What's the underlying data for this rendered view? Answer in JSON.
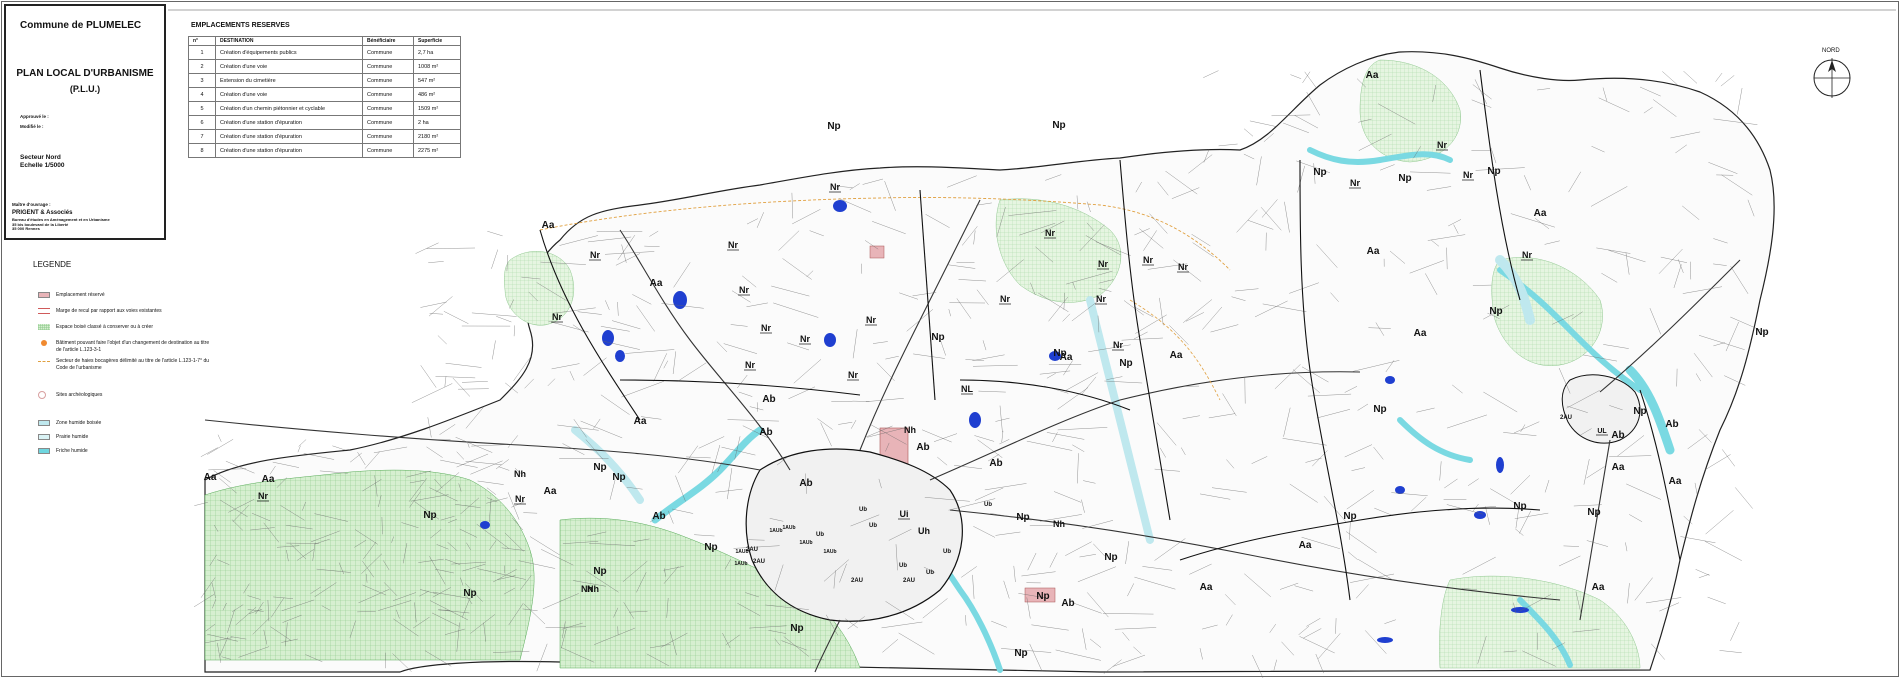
{
  "title_block": {
    "commune": "Commune de PLUMELEC",
    "plan_title": "PLAN LOCAL D'URBANISME",
    "plu": "(P.L.U.)",
    "approuve": "Approuvé le :",
    "modifie": "Modifié le :",
    "secteur": "Secteur Nord",
    "echelle": "Echelle 1/5000",
    "maitre": "Maître d'ouvrage :",
    "cabinet": "PRIGENT & Associés",
    "address_line1": "Bureau d'études en Aménagement et en Urbanisme",
    "address_line2": "35 bis boulevard de la Liberté",
    "address_line3": "35 000 Rennes"
  },
  "reserved": {
    "title": "EMPLACEMENTS RESERVES",
    "headers": [
      "n°",
      "DESTINATION",
      "Bénéficiaire",
      "Superficie"
    ],
    "rows": [
      [
        "1",
        "Création d'équipements publics",
        "Commune",
        "2,7 ha"
      ],
      [
        "2",
        "Création d'une voie",
        "Commune",
        "1008 m²"
      ],
      [
        "3",
        "Extension du cimetière",
        "Commune",
        "547 m²"
      ],
      [
        "4",
        "Création d'une voie",
        "Commune",
        "486 m²"
      ],
      [
        "5",
        "Création d'un chemin piétonnier et cyclable",
        "Commune",
        "1509 m²"
      ],
      [
        "6",
        "Création d'une station d'épuration",
        "Commune",
        "2 ha"
      ],
      [
        "7",
        "Création d'une station d'épuration",
        "Commune",
        "2180 m²"
      ],
      [
        "8",
        "Création d'une station d'épuration",
        "Commune",
        "2275 m²"
      ]
    ]
  },
  "legend": {
    "title": "LEGENDE",
    "items": [
      {
        "label": "Emplacement réservé",
        "color": "#e8b4b8",
        "style": "fill"
      },
      {
        "label": "Marge de recul par rapport aux voies existantes",
        "color": "#d05a5a",
        "style": "line"
      },
      {
        "label": "Espace boisé classé à conserver ou à créer",
        "color": "#9fd4a0",
        "style": "grid"
      },
      {
        "label": "Bâtiment pouvant faire l'objet d'un changement de destination au titre de l'article L.123-3-1",
        "color": "#f08a30",
        "style": "dot"
      },
      {
        "label": "Secteur de haies bocagères délimité au titre de l'article L.123-1-7° du Code de l'urbanisme",
        "color": "#e0a040",
        "style": "dash"
      },
      {
        "label": "Sites archéologiques",
        "color": "#d8a0a0",
        "style": "circle"
      },
      {
        "label": "Zone humide boisée",
        "color": "#bfe8ee",
        "style": "fill"
      },
      {
        "label": "Prairie humide",
        "color": "#daf3f5",
        "style": "fill"
      },
      {
        "label": "Friche humide",
        "color": "#6fd6df",
        "style": "fill"
      }
    ]
  },
  "north": {
    "label": "NORD"
  },
  "colors": {
    "boise": "#c9e7c4",
    "humide": "#7ad9e2",
    "eau": "#1f3fd0",
    "reserve": "#e8b4b8",
    "parcel": "#555555",
    "zone": "#111111"
  },
  "zones": [
    {
      "label": "Aa",
      "size": 10
    },
    {
      "label": "Aa",
      "size": 10
    },
    {
      "label": "Aa",
      "size": 10
    },
    {
      "label": "Aa",
      "size": 10
    },
    {
      "label": "Aa",
      "size": 10
    },
    {
      "label": "Aa",
      "size": 10
    },
    {
      "label": "Aa",
      "size": 10
    },
    {
      "label": "Aa",
      "size": 10
    },
    {
      "label": "Aa",
      "size": 10
    },
    {
      "label": "Aa",
      "size": 10
    },
    {
      "label": "Aa",
      "size": 10
    },
    {
      "label": "Aa",
      "size": 10
    },
    {
      "label": "Aa",
      "size": 10
    },
    {
      "label": "Aa",
      "size": 10
    },
    {
      "label": "Aa",
      "size": 10
    },
    {
      "label": "Aa",
      "size": 10
    },
    {
      "label": "Aa",
      "size": 10
    },
    {
      "label": "Ab",
      "size": 10
    },
    {
      "label": "Ab",
      "size": 10
    },
    {
      "label": "Ab",
      "size": 10
    },
    {
      "label": "Ab",
      "size": 10
    },
    {
      "label": "Ab",
      "size": 10
    },
    {
      "label": "Ab",
      "size": 10
    },
    {
      "label": "Ab",
      "size": 10
    },
    {
      "label": "Ab",
      "size": 10
    },
    {
      "label": "Ab",
      "size": 10
    },
    {
      "label": "Np",
      "size": 10
    },
    {
      "label": "Np",
      "size": 10
    },
    {
      "label": "Np",
      "size": 10
    },
    {
      "label": "Np",
      "size": 10
    },
    {
      "label": "Np",
      "size": 10
    },
    {
      "label": "Np",
      "size": 10
    },
    {
      "label": "Np",
      "size": 10
    },
    {
      "label": "Np",
      "size": 10
    },
    {
      "label": "Np",
      "size": 10
    },
    {
      "label": "Np",
      "size": 10
    },
    {
      "label": "Np",
      "size": 10
    },
    {
      "label": "Np",
      "size": 10
    },
    {
      "label": "Np",
      "size": 10
    },
    {
      "label": "Np",
      "size": 10
    },
    {
      "label": "Np",
      "size": 10
    },
    {
      "label": "Np",
      "size": 10
    },
    {
      "label": "Np",
      "size": 10
    },
    {
      "label": "Np",
      "size": 10
    },
    {
      "label": "Np",
      "size": 10
    },
    {
      "label": "Np",
      "size": 10
    },
    {
      "label": "Np",
      "size": 10
    },
    {
      "label": "Np",
      "size": 10
    },
    {
      "label": "Np",
      "size": 10
    },
    {
      "label": "Np",
      "size": 10
    },
    {
      "label": "Np",
      "size": 10
    },
    {
      "label": "Np",
      "size": 10
    },
    {
      "label": "Nr",
      "size": 9
    },
    {
      "label": "Nr",
      "size": 9
    },
    {
      "label": "Nr",
      "size": 9
    },
    {
      "label": "Nr",
      "size": 9
    },
    {
      "label": "Nr",
      "size": 9
    },
    {
      "label": "Nr",
      "size": 9
    },
    {
      "label": "Nr",
      "size": 9
    },
    {
      "label": "Nr",
      "size": 9
    },
    {
      "label": "Nr",
      "size": 9
    },
    {
      "label": "Nr",
      "size": 9
    },
    {
      "label": "Nr",
      "size": 9
    },
    {
      "label": "Nr",
      "size": 9
    },
    {
      "label": "Nr",
      "size": 9
    },
    {
      "label": "Nr",
      "size": 9
    },
    {
      "label": "Nr",
      "size": 9
    },
    {
      "label": "Nr",
      "size": 9
    },
    {
      "label": "Nr",
      "size": 9
    },
    {
      "label": "Nr",
      "size": 9
    },
    {
      "label": "Nr",
      "size": 9
    },
    {
      "label": "Nr",
      "size": 9
    },
    {
      "label": "Nr",
      "size": 9
    },
    {
      "label": "Nr",
      "size": 9
    },
    {
      "label": "Nr",
      "size": 9
    },
    {
      "label": "Nh",
      "size": 9
    },
    {
      "label": "Nh",
      "size": 9
    },
    {
      "label": "Nh",
      "size": 9
    },
    {
      "label": "Nh",
      "size": 9
    },
    {
      "label": "Nh",
      "size": 9
    },
    {
      "label": "NL",
      "size": 9
    },
    {
      "label": "UL",
      "size": 7
    },
    {
      "label": "Ui",
      "size": 9
    },
    {
      "label": "Uh",
      "size": 9
    },
    {
      "label": "Ub",
      "size": 6
    },
    {
      "label": "Ub",
      "size": 6
    },
    {
      "label": "Ub",
      "size": 6
    },
    {
      "label": "Ub",
      "size": 6
    },
    {
      "label": "Ub",
      "size": 6
    },
    {
      "label": "Ub",
      "size": 6
    },
    {
      "label": "Ub",
      "size": 6
    },
    {
      "label": "1AUb",
      "size": 5
    },
    {
      "label": "1AUb",
      "size": 5
    },
    {
      "label": "1AUb",
      "size": 5
    },
    {
      "label": "1AUb",
      "size": 5
    },
    {
      "label": "1AUb",
      "size": 5
    },
    {
      "label": "1AUb",
      "size": 5
    },
    {
      "label": "2AU",
      "size": 6
    },
    {
      "label": "2AU",
      "size": 6
    },
    {
      "label": "2AU",
      "size": 6
    },
    {
      "label": "2AU",
      "size": 6
    },
    {
      "label": "2AU",
      "size": 6
    },
    {
      "label": "Ua",
      "size": 6
    },
    {
      "label": "Ua",
      "size": 6
    },
    {
      "label": "1AUi",
      "size": 5
    }
  ]
}
